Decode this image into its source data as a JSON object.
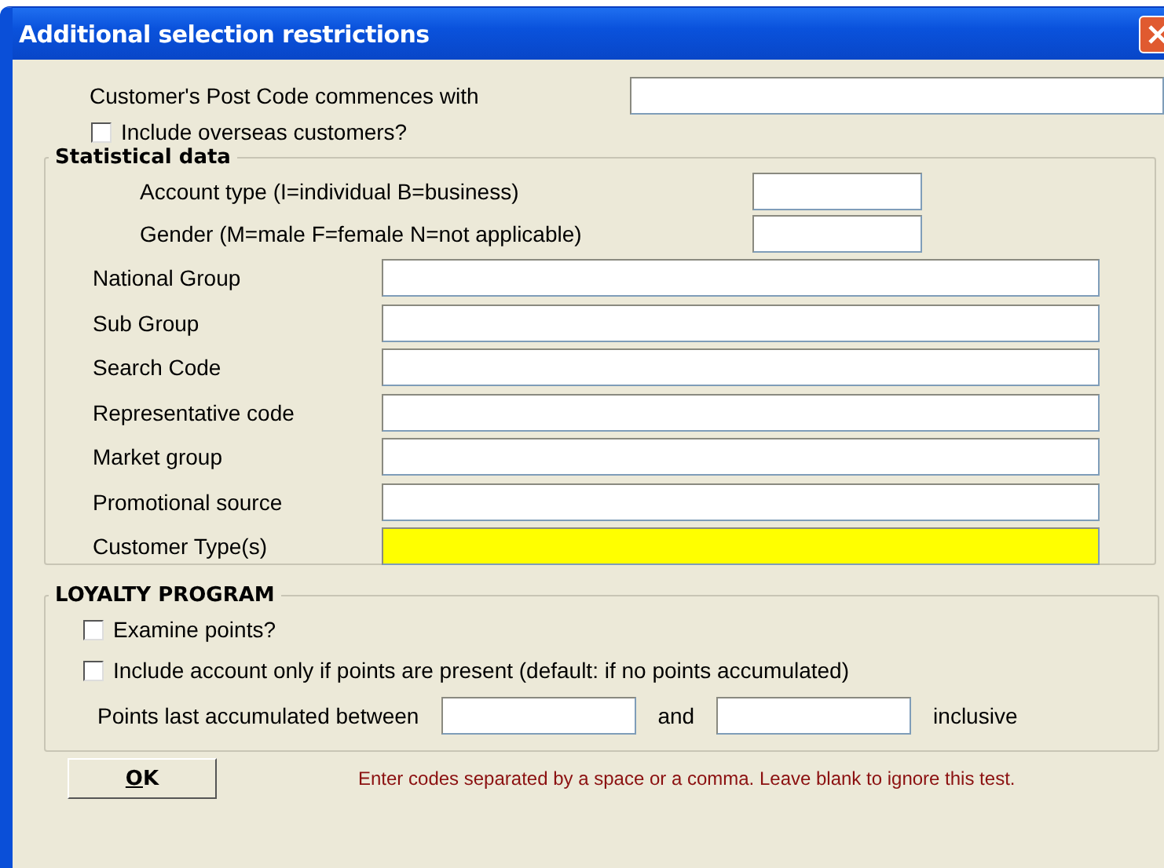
{
  "window": {
    "title": "Additional selection restrictions"
  },
  "post_code": {
    "label": "Customer's Post Code commences with"
  },
  "overseas": {
    "label": "Include overseas customers?",
    "checked": false
  },
  "statistical": {
    "title": "Statistical data",
    "short_fields": [
      {
        "label": "Account type (I=individual  B=business)"
      },
      {
        "label": "Gender  (M=male  F=female  N=not applicable)"
      }
    ],
    "fields": [
      {
        "label": "National Group",
        "highlighted": false
      },
      {
        "label": "Sub Group",
        "highlighted": false
      },
      {
        "label": "Search Code",
        "highlighted": false
      },
      {
        "label": "Representative code",
        "highlighted": false
      },
      {
        "label": "Market group",
        "highlighted": false
      },
      {
        "label": "Promotional source",
        "highlighted": false
      },
      {
        "label": "Customer Type(s)",
        "highlighted": true
      }
    ]
  },
  "loyalty": {
    "title": "LOYALTY PROGRAM",
    "checkboxes": [
      {
        "label": "Examine points?",
        "checked": false
      },
      {
        "label": "Include account only if points are present (default: if no points accumulated)",
        "checked": false
      }
    ],
    "range": {
      "label": "Points last accumulated between",
      "joiner": "and",
      "suffix": "inclusive"
    }
  },
  "ok_button": "OK",
  "hint": "Enter codes separated by a space or a comma.   Leave blank to ignore this test."
}
